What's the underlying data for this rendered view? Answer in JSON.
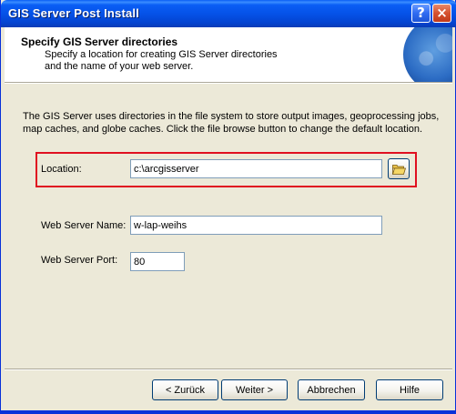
{
  "window": {
    "title": "GIS Server Post Install",
    "help_label": "?",
    "close_label": "×"
  },
  "header": {
    "title": "Specify GIS Server directories",
    "subtitle_line1": "Specify a location for creating GIS Server directories",
    "subtitle_line2": "and the name of your web server."
  },
  "body": {
    "description_line1": "The GIS Server uses directories in the file system to store output images, geoprocessing jobs,",
    "description_line2": "map caches, and globe caches.  Click the file browse button to change the default location."
  },
  "form": {
    "location_label": "Location:",
    "location_value": "c:\\arcgisserver",
    "web_server_name_label": "Web Server Name:",
    "web_server_name_value": "w-lap-weihs",
    "web_server_port_label": "Web Server Port:",
    "web_server_port_value": "80"
  },
  "buttons": {
    "back": "< Zurück",
    "next": "Weiter >",
    "cancel": "Abbrechen",
    "help": "Hilfe"
  },
  "icons": {
    "browse": "folder-open-icon",
    "globe": "globe-icon"
  },
  "colors": {
    "highlight": "#e01020",
    "titlebar": "#0552e8",
    "dialog_bg": "#ece9d8"
  }
}
